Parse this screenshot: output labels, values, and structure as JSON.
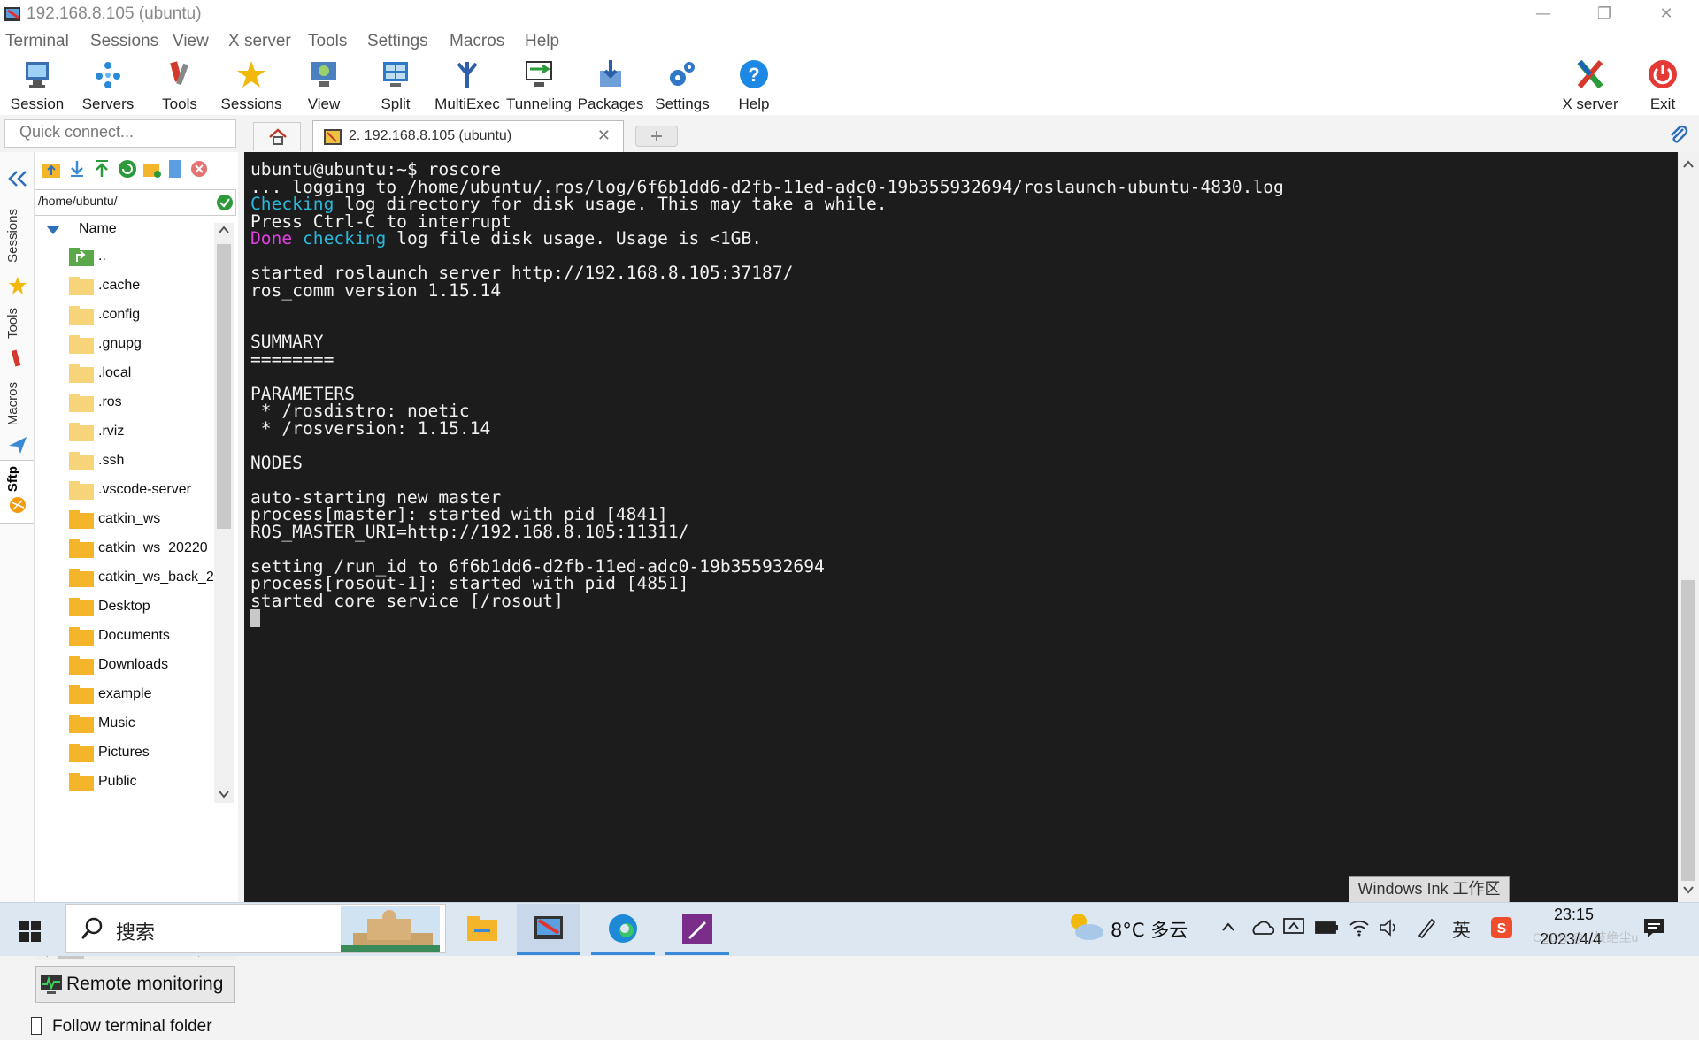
{
  "window": {
    "title": "192.168.8.105 (ubuntu)",
    "minimize": "—",
    "restore": "❐",
    "close": "✕"
  },
  "menu": [
    "Terminal",
    "Sessions",
    "View",
    "X server",
    "Tools",
    "Settings",
    "Macros",
    "Help"
  ],
  "toolbar": {
    "session": "Session",
    "servers": "Servers",
    "tools": "Tools",
    "sessions": "Sessions",
    "view": "View",
    "split": "Split",
    "multiexec": "MultiExec",
    "tunneling": "Tunneling",
    "packages": "Packages",
    "settings": "Settings",
    "help": "Help",
    "xserver": "X server",
    "exit": "Exit"
  },
  "quick_connect": {
    "placeholder": "Quick connect..."
  },
  "tabs": {
    "active_label": "2. 192.168.8.105 (ubuntu)",
    "close": "✕"
  },
  "side_tabs": [
    "Sessions",
    "Tools",
    "Macros",
    "Sftp"
  ],
  "sftp": {
    "path": "/home/ubuntu/",
    "column_name": "Name",
    "files": [
      "..",
      ".cache",
      ".config",
      ".gnupg",
      ".local",
      ".ros",
      ".rviz",
      ".ssh",
      ".vscode-server",
      "catkin_ws",
      "catkin_ws_20220",
      "catkin_ws_back_2",
      "Desktop",
      "Documents",
      "Downloads",
      "example",
      "Music",
      "Pictures",
      "Public"
    ],
    "remote_monitoring": "Remote monitoring",
    "follow_folder": "Follow terminal folder"
  },
  "terminal": {
    "lines": [
      "ubuntu@ubuntu:~$ roscore",
      "... logging to /home/ubuntu/.ros/log/6f6b1dd6-d2fb-11ed-adc0-19b355932694/roslaunch-ubuntu-4830.log",
      "Checking log directory for disk usage. This may take a while.",
      "Press Ctrl-C to interrupt",
      "Done checking log file disk usage. Usage is <1GB.",
      "",
      "started roslaunch server http://192.168.8.105:37187/",
      "ros_comm version 1.15.14",
      "",
      "",
      "SUMMARY",
      "========",
      "",
      "PARAMETERS",
      " * /rosdistro: noetic",
      " * /rosversion: 1.15.14",
      "",
      "NODES",
      "",
      "auto-starting new master",
      "process[master]: started with pid [4841]",
      "ROS_MASTER_URI=http://192.168.8.105:11311/",
      "",
      "setting /run_id to 6f6b1dd6-d2fb-11ed-adc0-19b355932694",
      "process[rosout-1]: started with pid [4851]",
      "started core service [/rosout]"
    ],
    "colors": {
      "cyan": "#29b8db",
      "magenta": "#e040e0",
      "text": "#f0f0f0",
      "background": "#1c1c1c"
    }
  },
  "ink_badge": "Windows Ink 工作区",
  "taskbar": {
    "search_label": "搜索",
    "weather": "8°C 多云",
    "ime": "英",
    "time": "23:15",
    "date": "2023/4/4",
    "watermark": "CSDN @...技绝尘u"
  }
}
